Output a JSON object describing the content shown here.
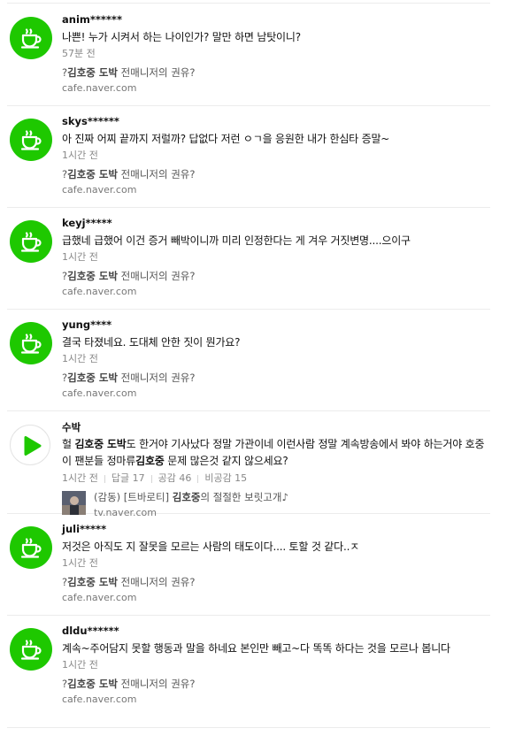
{
  "related_link": {
    "prefix": "?",
    "keyword": "김호중 도박",
    "suffix": " 전매니저의 권유?",
    "url": "cafe.naver.com"
  },
  "comments": [
    {
      "author": "anim******",
      "text": "나쁜! 누가 시켜서 하는 나이인가? 말만 하면 남탓이니?",
      "time": "57분 전",
      "avatar_icon": "cafe-cup-icon"
    },
    {
      "author": "skys******",
      "text": "아 진짜 어찌 끝까지 저럴까? 답없다 저런 ㅇㄱ을 응원한 내가 한심타 증말~",
      "time": "1시간 전",
      "avatar_icon": "cafe-cup-icon"
    },
    {
      "author": "keyj*****",
      "text": "급했네 급했어 이건 증거 빼박이니까 미리 인정한다는 게 겨우 거짓변명....으이구",
      "time": "1시간 전",
      "avatar_icon": "cafe-cup-icon"
    },
    {
      "author": "yung****",
      "text": "결국 타졌네요. 도대체 안한 짓이 뭔가요?",
      "time": "1시간 전",
      "avatar_icon": "cafe-cup-icon"
    }
  ],
  "special": {
    "author": "수박",
    "text_parts": [
      "헐 ",
      "김호중 도박",
      "도 한거야 기사났다 정말 가관이네 이런사람 정말 계속방송에서 봐야 하는거야 호중이 팬분들 정마류",
      "김호중",
      " 문제 많은것 같지 않으세요?"
    ],
    "time": "1시간 전",
    "replies": "답글 17",
    "likes": "공감 46",
    "dislikes": "비공감 15",
    "card_prefix": "(감동) [트바로티] ",
    "card_keyword": "김호중",
    "card_suffix": "의 절절한 보릿고개♪",
    "card_url": "tv.naver.com",
    "avatar_icon": "play-icon",
    "brand_color": "#1ec800"
  },
  "comments_after": [
    {
      "author": "juli*****",
      "text": "저것은 아직도 지 잘못을 모르는 사람의 태도이다.... 토할 것 같다..ㅈ",
      "time": "1시간 전",
      "avatar_icon": "cafe-cup-icon"
    },
    {
      "author": "dldu******",
      "text": "계속~주어담지 못할 행동과 말을 하네요 본인만 빼고~다 똑똑 하다는 것을 모르나 봅니다",
      "time": "1시간 전",
      "avatar_icon": "cafe-cup-icon"
    }
  ]
}
